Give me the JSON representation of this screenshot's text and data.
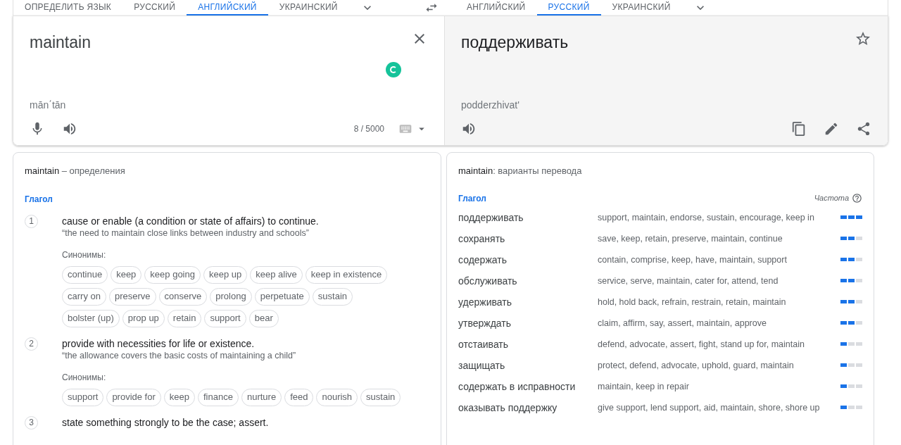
{
  "source_tabs": [
    {
      "label": "ОПРЕДЕЛИТЬ ЯЗЫК",
      "selected": false
    },
    {
      "label": "РУССКИЙ",
      "selected": false
    },
    {
      "label": "АНГЛИЙСКИЙ",
      "selected": true
    },
    {
      "label": "УКРАИНСКИЙ",
      "selected": false
    }
  ],
  "target_tabs": [
    {
      "label": "АНГЛИЙСКИЙ",
      "selected": false
    },
    {
      "label": "РУССКИЙ",
      "selected": true
    },
    {
      "label": "УКРАИНСКИЙ",
      "selected": false
    }
  ],
  "source": {
    "text": "maintain",
    "transliteration": "mān΄tān",
    "char_count": "8 / 5000"
  },
  "target": {
    "text": "поддерживать",
    "transliteration": "podderzhivat'"
  },
  "definitions": {
    "word": "maintain",
    "title": " – определения",
    "part_of_speech": "Глагол",
    "senses": [
      {
        "number": "1",
        "definition": "cause or enable (a condition or state of affairs) to continue.",
        "example": "“the need to maintain close links between industry and schools”",
        "synonyms_label": "Синонимы:",
        "synonyms": [
          "continue",
          "keep",
          "keep going",
          "keep up",
          "keep alive",
          "keep in existence",
          "carry on",
          "preserve",
          "conserve",
          "prolong",
          "perpetuate",
          "sustain",
          "bolster (up)",
          "prop up",
          "retain",
          "support",
          "bear"
        ]
      },
      {
        "number": "2",
        "definition": "provide with necessities for life or existence.",
        "example": "“the allowance covers the basic costs of maintaining a child”",
        "synonyms_label": "Синонимы:",
        "synonyms": [
          "support",
          "provide for",
          "keep",
          "finance",
          "nurture",
          "feed",
          "nourish",
          "sustain"
        ]
      },
      {
        "number": "3",
        "definition": "state something strongly to be the case; assert."
      }
    ]
  },
  "translations": {
    "word": "maintain",
    "title": ": варианты перевода",
    "part_of_speech": "Глагол",
    "frequency_label": "Частота",
    "rows": [
      {
        "term": "поддерживать",
        "synonyms": "support, maintain, endorse, sustain, encourage, keep in",
        "stars": 3
      },
      {
        "term": "сохранять",
        "synonyms": "save, keep, retain, preserve, maintain, continue",
        "stars": 2
      },
      {
        "term": "содержать",
        "synonyms": "contain, comprise, keep, have, maintain, support",
        "stars": 2
      },
      {
        "term": "обслуживать",
        "synonyms": "service, serve, maintain, cater for, attend, tend",
        "stars": 2
      },
      {
        "term": "удерживать",
        "synonyms": "hold, hold back, refrain, restrain, retain, maintain",
        "stars": 2
      },
      {
        "term": "утверждать",
        "synonyms": "claim, affirm, say, assert, maintain, approve",
        "stars": 2
      },
      {
        "term": "отстаивать",
        "synonyms": "defend, advocate, assert, fight, stand up for, maintain",
        "stars": 1
      },
      {
        "term": "защищать",
        "synonyms": "protect, defend, advocate, uphold, guard, maintain",
        "stars": 1
      },
      {
        "term": "содержать в исправности",
        "synonyms": "maintain, keep in repair",
        "stars": 1
      },
      {
        "term": "оказывать поддержку",
        "synonyms": "give support, lend support, aid, maintain, shore, shore up",
        "stars": 1
      }
    ]
  }
}
